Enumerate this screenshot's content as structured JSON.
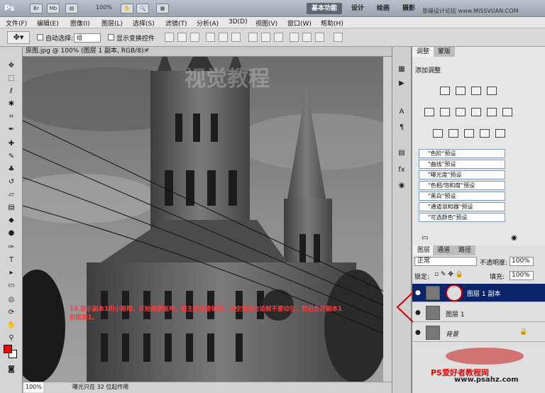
{
  "app": {
    "logo": "Ps",
    "zoom": "100%",
    "workspaces": [
      "基本功能",
      "设计",
      "绘画",
      "摄影"
    ],
    "watermark": "思缘设计论坛 www.MISSVUAN.COM"
  },
  "menus": [
    "文件(F)",
    "编辑(E)",
    "图像(I)",
    "图层(L)",
    "选择(S)",
    "滤镜(T)",
    "分析(A)",
    "3D(D)",
    "视图(V)",
    "窗口(W)",
    "帮助(H)"
  ],
  "options": {
    "auto_select_label": "自动选择:",
    "auto_select_value": "组",
    "show_transform_label": "显示变换控件"
  },
  "document": {
    "tab_title": "原图.jpg @ 100% (图层 1 副本, RGB/8) *",
    "zoom": "100%",
    "status": "曝光只在 32 位起作用",
    "canvas_watermark": "视觉教程"
  },
  "annotation": "13.显示副本1的小眼睛，开始擦蒙板吧，擦主要是建筑物，天空觉得合适就不要动它，然后合并副本1和图层1。",
  "adjustments": {
    "tabs": [
      "调整",
      "蒙版"
    ],
    "title": "添加调整",
    "presets": [
      "\"色阶\"预设",
      "\"曲线\"预设",
      "\"曝光度\"预设",
      "\"色相/饱和度\"预设",
      "\"黑白\"预设",
      "\"通道混和器\"预设",
      "\"可选颜色\"预设"
    ]
  },
  "layers": {
    "tabs": [
      "图层",
      "通道",
      "路径"
    ],
    "blend_mode": "正常",
    "opacity_label": "不透明度:",
    "opacity": "100%",
    "lock_label": "锁定:",
    "fill_label": "填充:",
    "fill": "100%",
    "items": [
      {
        "name": "图层 1 副本",
        "selected": true
      },
      {
        "name": "图层 1",
        "selected": false
      },
      {
        "name": "背景",
        "selected": false
      }
    ]
  },
  "brand": {
    "text": "PS爱好者教程网",
    "url": "www.psahz.com"
  },
  "colors": {
    "foreground": "#ff0000",
    "background": "#ffffff",
    "selection": "#0a246a",
    "accent": "#d00000"
  }
}
